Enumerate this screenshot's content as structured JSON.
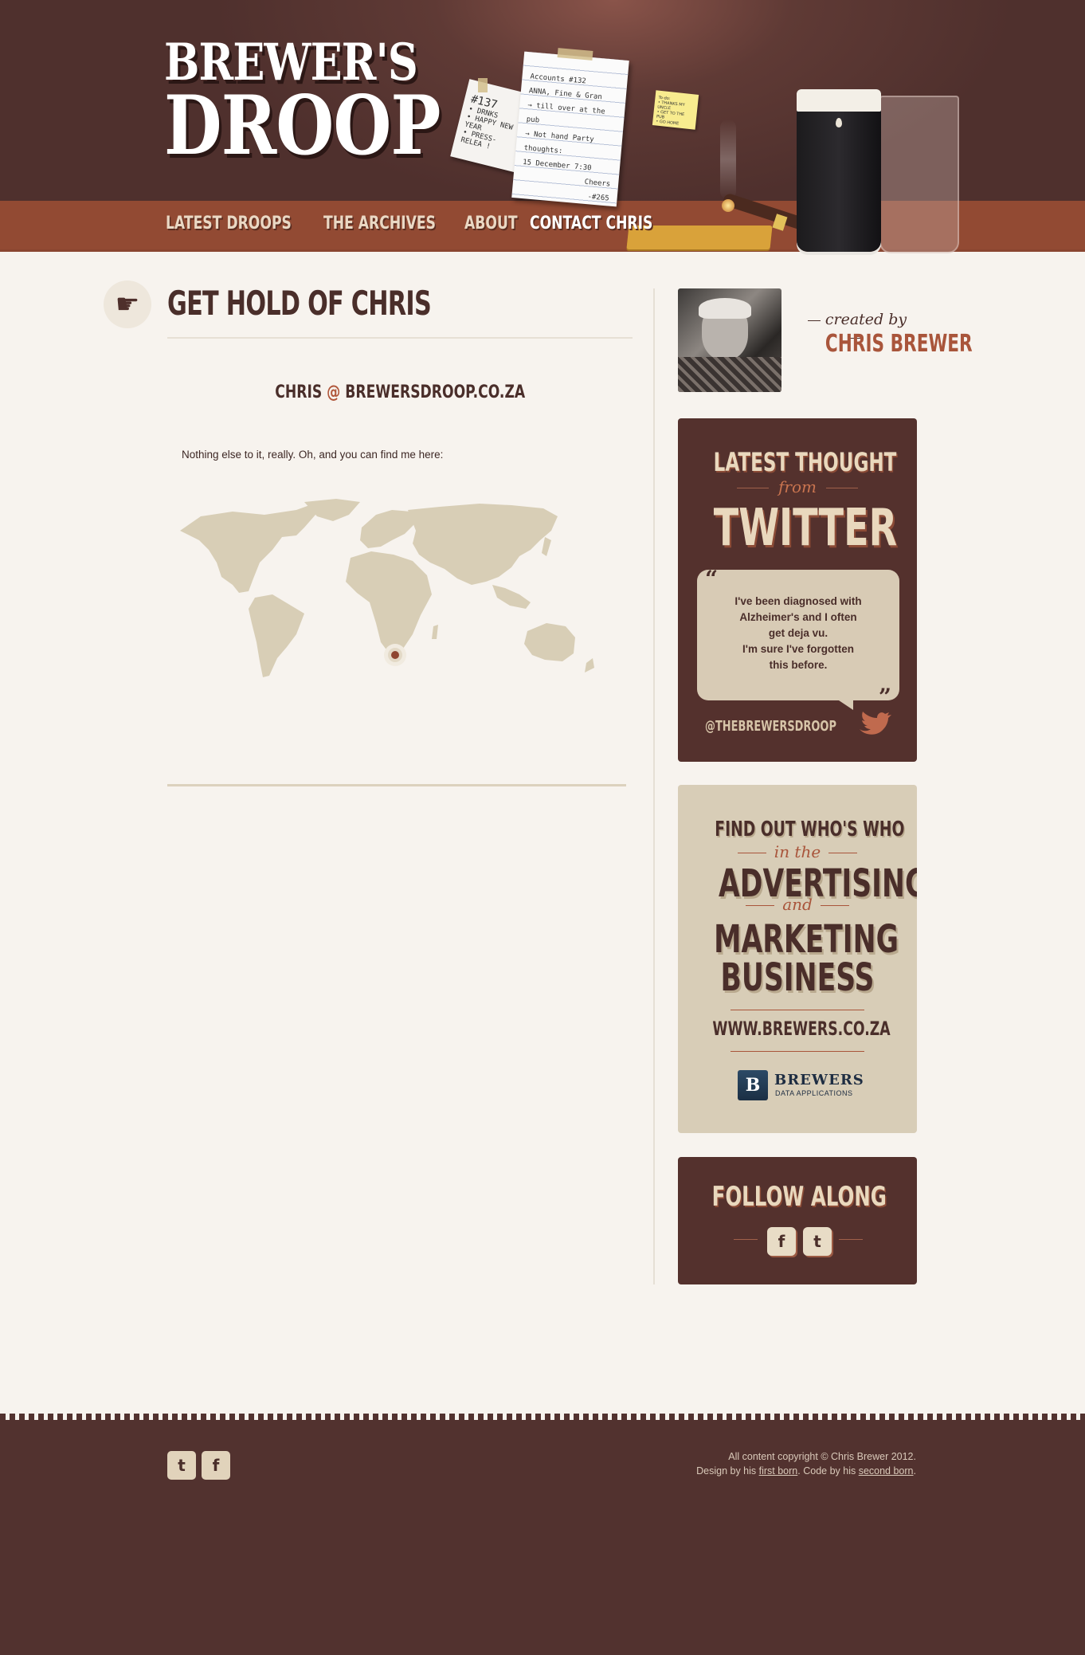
{
  "site": {
    "logo_line1": "BREWER'S",
    "logo_line2": "DROOP"
  },
  "nav": {
    "items": [
      {
        "label": "LATEST DROOPS"
      },
      {
        "label": "THE ARCHIVES"
      },
      {
        "label": "ABOUT"
      },
      {
        "label": "CONTACT CHRIS",
        "active": true
      }
    ]
  },
  "header_props": {
    "note_small_lines": [
      "#137",
      "• DRNKS",
      "• HAPPY NEW YEAR",
      "• PRESS-RELEA !"
    ],
    "note_large_lines": [
      "Accounts #132",
      "ANNA, Fine & Gran",
      "→ till over at the pub",
      "→ Not hand Party",
      "thoughts:",
      "15 December 7:30",
      "Cheers",
      "-#265"
    ],
    "sticky_lines": [
      "To-do:",
      "• THANKS MY UNCLE",
      "• GET TO THE PUB",
      "• GO HOME"
    ]
  },
  "main": {
    "title": "GET HOLD OF CHRIS",
    "email_user": "CHRIS",
    "email_at": "@",
    "email_domain": "BREWERSDROOP.CO.ZA",
    "intro": "Nothing else to it, really. Oh, and you can find me here:"
  },
  "sidebar": {
    "created_by": "created by",
    "creator_name": "CHRIS BREWER",
    "twitter": {
      "heading1": "LATEST THOUGHT",
      "heading2": "from",
      "heading3": "TWITTER",
      "tweet_lines": [
        "I've been diagnosed with",
        "Alzheimer's and I often",
        "get deja vu.",
        "I'm sure I've forgotten",
        "this before."
      ],
      "handle": "@THEBREWERSDROOP"
    },
    "ad": {
      "line1": "FIND OUT WHO'S WHO",
      "line2": "in the",
      "line3": "ADVERTISING",
      "line4": "and",
      "line5": "MARKETING",
      "line6": "BUSINESS",
      "url": "WWW.BREWERS.CO.ZA",
      "brand_letter": "B",
      "brand_name": "BREWERS",
      "brand_sub": "DATA APPLICATIONS"
    },
    "follow": {
      "heading": "FOLLOW ALONG",
      "facebook_glyph": "f",
      "twitter_glyph": "t"
    }
  },
  "footer": {
    "twitter_glyph": "t",
    "facebook_glyph": "f",
    "copyright": "All content copyright © Chris Brewer 2012.",
    "design_prefix": "Design by his ",
    "design_link": "first born",
    "code_prefix": ". Code by his ",
    "code_link": "second born",
    "suffix": "."
  },
  "colors": {
    "header_brown": "#52322f",
    "nav_rust": "#924a33",
    "accent": "#a9553b",
    "cream": "#d8cdb7",
    "page_bg": "#f7f3ee"
  }
}
